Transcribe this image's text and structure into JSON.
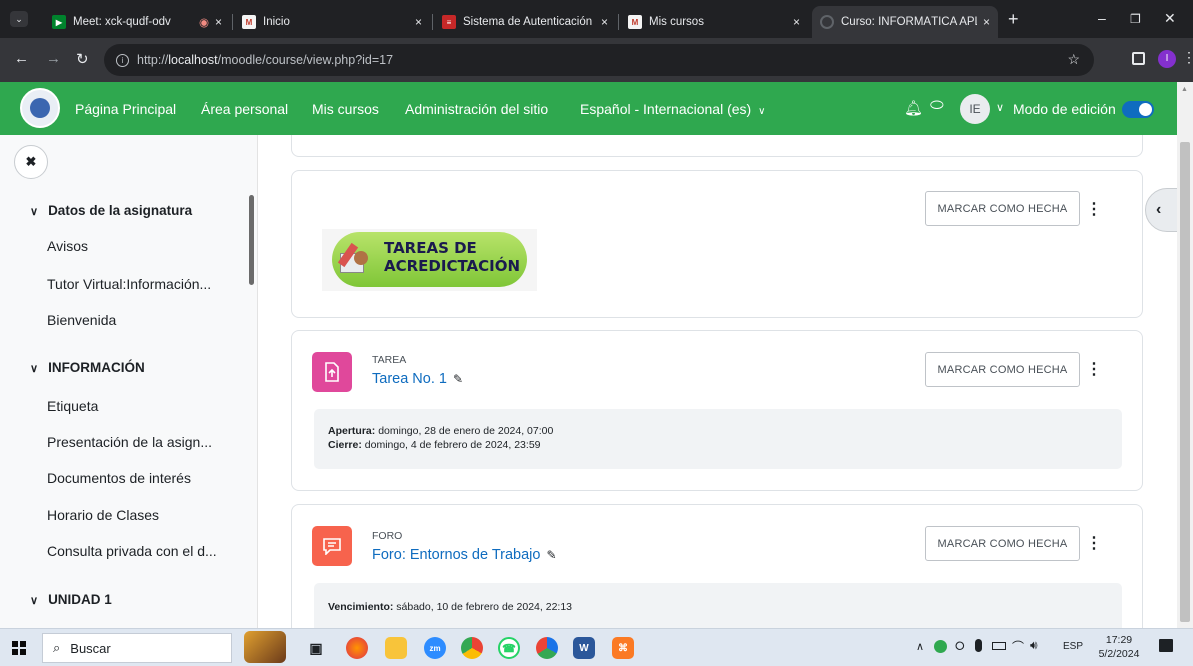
{
  "browser": {
    "tabs": [
      {
        "title": "Meet: xck-qudf-odv",
        "rec": "◉",
        "close": "×"
      },
      {
        "title": "Inicio",
        "close": "×"
      },
      {
        "title": "Sistema de Autenticación Ce",
        "close": "×"
      },
      {
        "title": "Mis cursos",
        "close": "×"
      },
      {
        "title": "Curso: INFORMÁTICA APLIC",
        "close": "×"
      }
    ],
    "new_tab": "+",
    "url_prefix": "http://",
    "url_host": "localhost",
    "url_path": "/moodle/course/view.php?id=17",
    "profile_initial": "I"
  },
  "navbar": {
    "home": "Página Principal",
    "dashboard": "Área personal",
    "my_courses": "Mis cursos",
    "admin": "Administración del sitio",
    "language": "Español - Internacional (es)",
    "user_initials": "IE",
    "edit_mode": "Modo de edición"
  },
  "drawer": {
    "sections": [
      {
        "title": "Datos de la asignatura",
        "items": [
          "Avisos",
          "Tutor Virtual:Información...",
          "Bienvenida"
        ]
      },
      {
        "title": "INFORMACIÓN",
        "items": [
          "Etiqueta",
          "Presentación de la asign...",
          "Documentos de interés",
          "Horario de Clases",
          "Consulta privada con el d..."
        ]
      },
      {
        "title": "UNIDAD 1",
        "items": []
      }
    ]
  },
  "main": {
    "mark_done": "MARCAR COMO HECHA",
    "banner": {
      "line1": "TAREAS DE",
      "line2": "ACREDICTACIÓN"
    },
    "activities": [
      {
        "type": "TAREA",
        "name": "Tarea No. 1",
        "color": "#e0489b",
        "dates": [
          {
            "label": "Apertura:",
            "value": "domingo, 28 de enero de 2024, 07:00"
          },
          {
            "label": "Cierre:",
            "value": "domingo, 4 de febrero de 2024, 23:59"
          }
        ]
      },
      {
        "type": "FORO",
        "name": "Foro: Entornos de Trabajo",
        "color": "#f7634d",
        "dates": [
          {
            "label": "Vencimiento:",
            "value": "sábado, 10 de febrero de 2024, 22:13"
          }
        ]
      }
    ]
  },
  "taskbar": {
    "search": "Buscar",
    "lang": "ESP",
    "time": "17:29",
    "date": "5/2/2024"
  },
  "colors": {
    "moodle_green": "#2fa84f",
    "link_blue": "#0f6cbf"
  }
}
